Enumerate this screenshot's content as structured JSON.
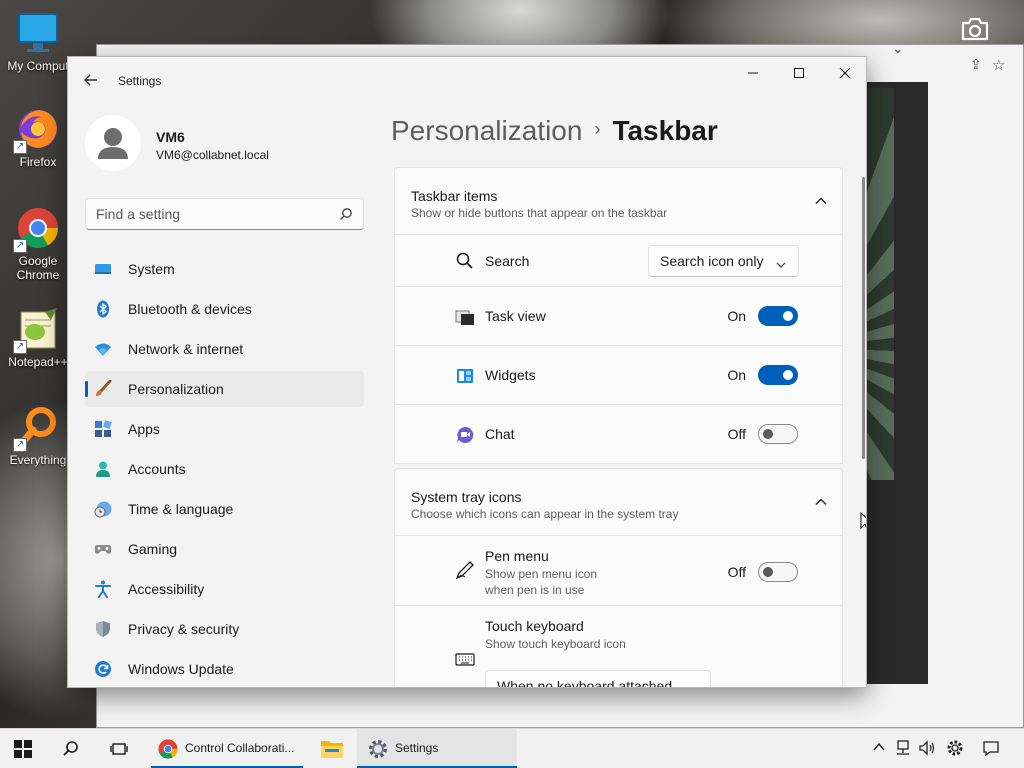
{
  "desktop": {
    "icons": [
      {
        "label": "My Comput"
      },
      {
        "label": "Firefox"
      },
      {
        "label": "Google Chrome"
      },
      {
        "label": "Notepad++"
      },
      {
        "label": "Everything"
      }
    ]
  },
  "window": {
    "title": "Settings"
  },
  "profile": {
    "name": "VM6",
    "email": "VM6@collabnet.local"
  },
  "search": {
    "placeholder": "Find a setting"
  },
  "nav": {
    "items": [
      {
        "label": "System",
        "icon": "monitor-icon"
      },
      {
        "label": "Bluetooth & devices",
        "icon": "bluetooth-icon"
      },
      {
        "label": "Network & internet",
        "icon": "wifi-icon"
      },
      {
        "label": "Personalization",
        "icon": "brush-icon",
        "active": true
      },
      {
        "label": "Apps",
        "icon": "apps-icon"
      },
      {
        "label": "Accounts",
        "icon": "accounts-icon"
      },
      {
        "label": "Time & language",
        "icon": "clock-globe-icon"
      },
      {
        "label": "Gaming",
        "icon": "gamepad-icon"
      },
      {
        "label": "Accessibility",
        "icon": "accessibility-icon"
      },
      {
        "label": "Privacy & security",
        "icon": "shield-icon"
      },
      {
        "label": "Windows Update",
        "icon": "update-icon"
      }
    ]
  },
  "breadcrumb": {
    "parent": "Personalization",
    "separator": "›",
    "current": "Taskbar"
  },
  "sections": {
    "taskbar_items": {
      "title": "Taskbar items",
      "subtitle": "Show or hide buttons that appear on the taskbar",
      "search": {
        "label": "Search",
        "value": "Search icon only"
      },
      "task_view": {
        "label": "Task view",
        "state": "On"
      },
      "widgets": {
        "label": "Widgets",
        "state": "On"
      },
      "chat": {
        "label": "Chat",
        "state": "Off"
      }
    },
    "system_tray": {
      "title": "System tray icons",
      "subtitle": "Choose which icons can appear in the system tray",
      "pen_menu": {
        "label": "Pen menu",
        "sub1": "Show pen menu icon",
        "sub2": "when pen is in use",
        "state": "Off"
      },
      "touch_keyboard": {
        "label": "Touch keyboard",
        "sub": "Show touch keyboard icon",
        "value": "When no keyboard attached"
      }
    }
  },
  "taskbar": {
    "apps": [
      {
        "label": "Control Collaborati...",
        "icon": "chrome-icon"
      },
      {
        "label": "",
        "icon": "folder-icon"
      },
      {
        "label": "Settings",
        "icon": "gear-icon"
      }
    ]
  },
  "colors": {
    "accent": "#005fb8",
    "window_bg": "#f3f3f3",
    "card_bg": "#fbfbfb"
  }
}
